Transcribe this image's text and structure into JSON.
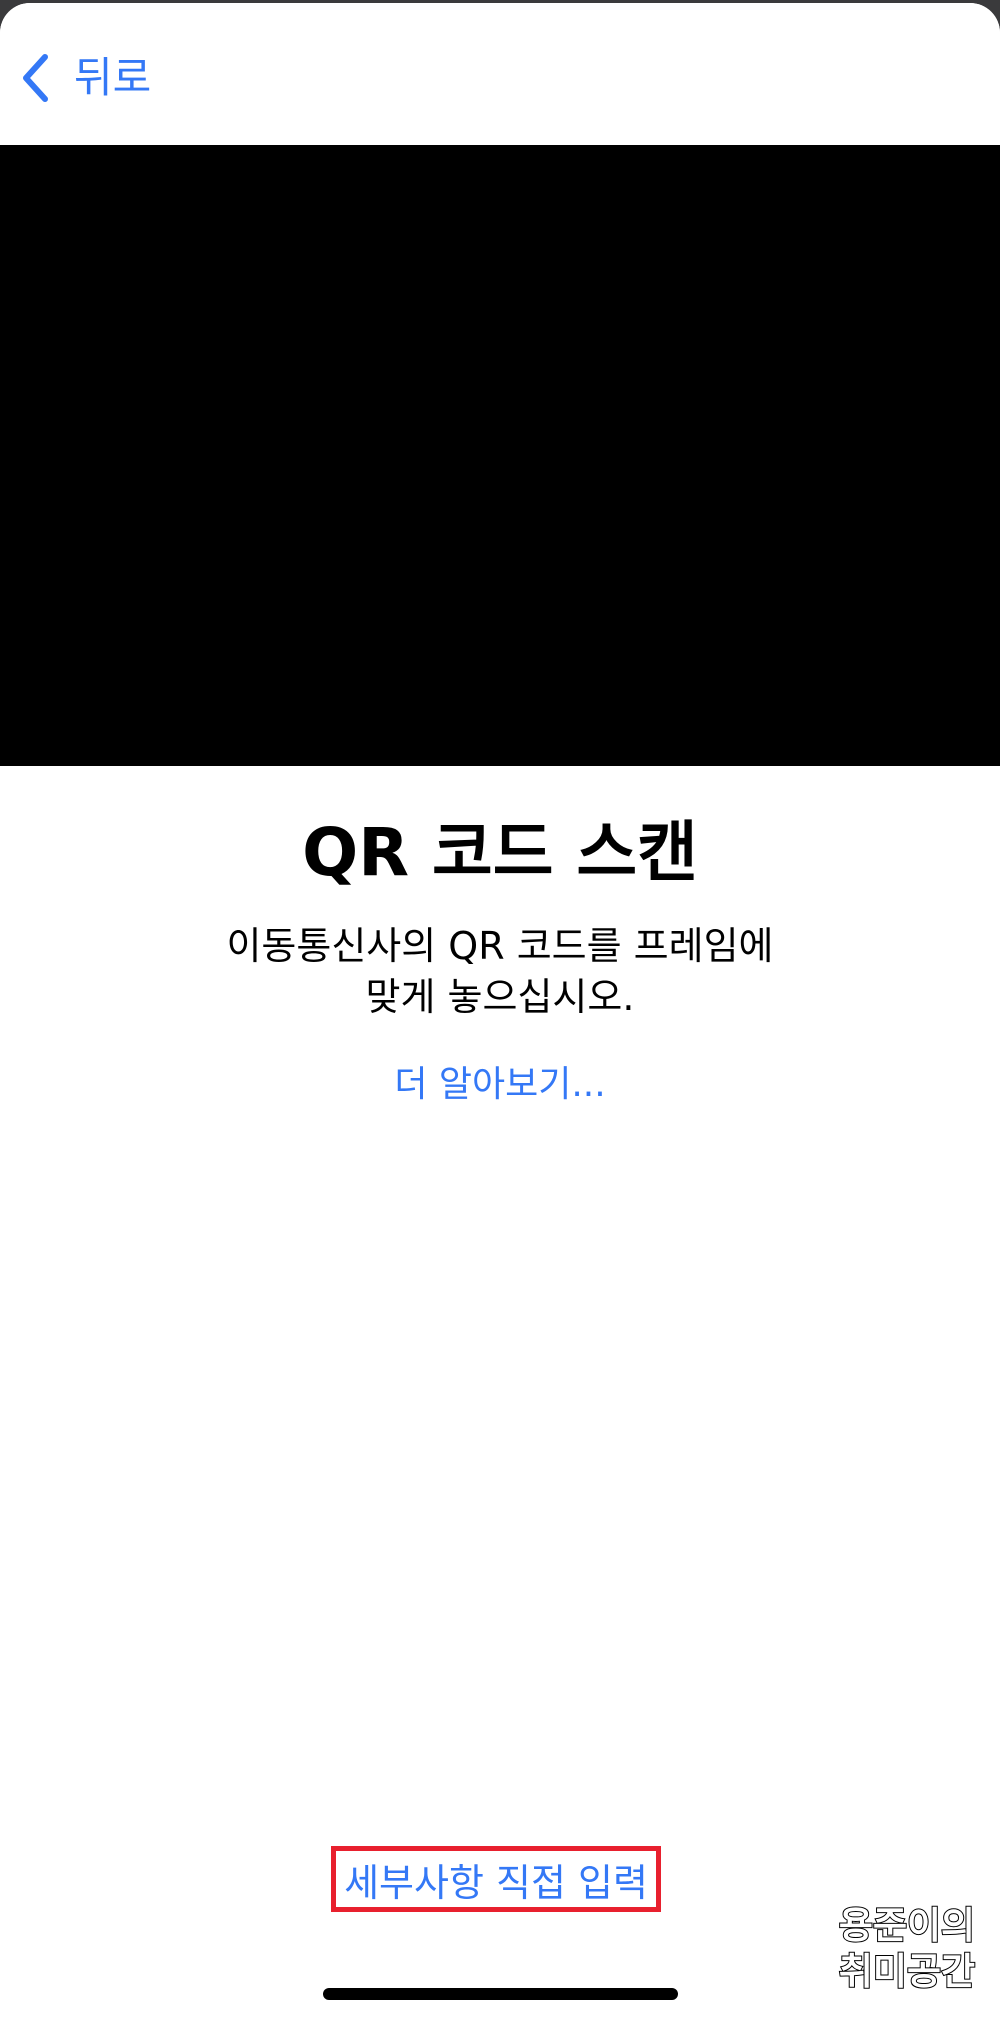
{
  "nav": {
    "back_label": "뒤로",
    "back_icon": "chevron-left-icon"
  },
  "camera": {
    "state": "black"
  },
  "content": {
    "title": "QR 코드 스캔",
    "description_line1": "이동통신사의 QR 코드를 프레임에",
    "description_line2": "맞게 놓으십시오.",
    "learn_more": "더 알아보기..."
  },
  "footer": {
    "manual_entry": "세부사항 직접 입력"
  },
  "watermark": {
    "line1": "용준이의",
    "line2": "취미공간"
  },
  "colors": {
    "accent": "#3478f6",
    "highlight_border": "#e8202e",
    "camera_background": "#000000"
  }
}
